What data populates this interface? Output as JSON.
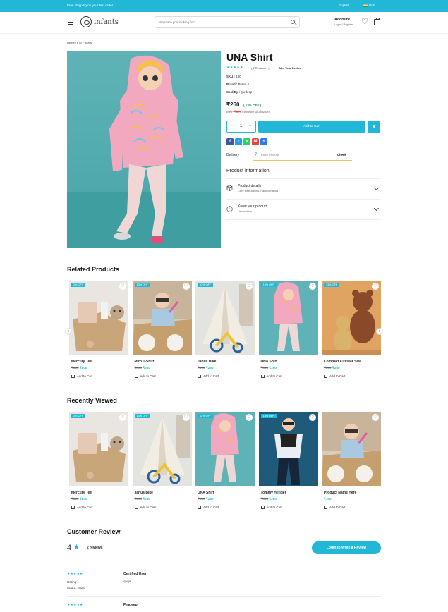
{
  "topbar": {
    "promo": "Free shipping on your first order",
    "language": "English",
    "currency": "INR"
  },
  "header": {
    "logo": "infants",
    "search_placeholder": "What are you looking for?",
    "account_title": "Account",
    "account_sub": "Login / Register"
  },
  "breadcrumb": {
    "home": "Home",
    "sep": "/",
    "current": "6 to 7 years"
  },
  "product": {
    "title": "UNA Shirt",
    "stars": "★★★★★",
    "reviews": "( 2 Reviews )  |",
    "add_review": "Add Your Review",
    "sku_label": "SKU :",
    "sku": "130",
    "brand_label": "Brand :",
    "brand": "Brand 4",
    "sold_label": "Sold By :",
    "sold": "gurdeep",
    "price": "₹260",
    "discount": "( 13% OFF )",
    "mrp_label": "MRP",
    "mrp": "₹300",
    "tax_note": "Inclusive of all taxes",
    "qty": "1",
    "add_to_cart": "Add to Cart",
    "delivery_label": "Delivery",
    "pincode_placeholder": "Enter Pincode",
    "check": "Check",
    "info_title": "Product information",
    "details_title": "Product details",
    "details_sub": "Care instructions, Pack contains",
    "know_title": "Know your product",
    "know_sub": "Description",
    "share": [
      {
        "name": "facebook-icon",
        "glyph": "f",
        "color": "#3b5998"
      },
      {
        "name": "twitter-icon",
        "glyph": "t",
        "color": "#1da1f2"
      },
      {
        "name": "whatsapp-icon",
        "glyph": "w",
        "color": "#25d366"
      },
      {
        "name": "gmail-icon",
        "glyph": "M",
        "color": "#e8453c"
      },
      {
        "name": "share-more-icon",
        "glyph": "+",
        "color": "#2c7be5"
      }
    ]
  },
  "related": {
    "title": "Related Products",
    "items": [
      {
        "badge": "2% OFF",
        "name": "Mercury Tee",
        "mrp": "₹820",
        "price": "₹800",
        "img": "box"
      },
      {
        "badge": "13% OFF",
        "name": "Miro T-Shirt",
        "mrp": "₹300",
        "price": "₹260",
        "img": "boxkid"
      },
      {
        "badge": "13% OFF",
        "name": "Janus Bike",
        "mrp": "₹300",
        "price": "₹260",
        "img": "tent"
      },
      {
        "badge": "13% OFF",
        "name": "UNA Shirt",
        "mrp": "₹300",
        "price": "₹260",
        "img": "girl"
      },
      {
        "badge": "13% OFF",
        "name": "Compact Circular Saw",
        "mrp": "₹300",
        "price": "₹260",
        "img": "bears"
      }
    ]
  },
  "recent": {
    "title": "Recently Viewed",
    "items": [
      {
        "badge": "2% OFF",
        "name": "Mercury Tee",
        "mrp": "₹820",
        "price": "₹800",
        "img": "box"
      },
      {
        "badge": "13% OFF",
        "name": "Janus Bike",
        "mrp": "₹300",
        "price": "₹260",
        "img": "tent"
      },
      {
        "badge": "13% OFF",
        "name": "UNA Shirt",
        "mrp": "₹300",
        "price": "₹260",
        "img": "girl"
      },
      {
        "badge": "13% OFF",
        "name": "Tommy Hilfiger",
        "mrp": "₹300",
        "price": "₹260",
        "img": "boy"
      },
      {
        "badge": "",
        "name": "Product Name Here",
        "mrp": "",
        "price": "₹100",
        "img": "boxkid"
      }
    ]
  },
  "card_add": "Add to Cart",
  "review": {
    "title": "Customer Review",
    "rating": "4",
    "star": "★",
    "count": "2 reviews",
    "login_btn": "Login to Write a Review",
    "entries": [
      {
        "stars": "★★★★★",
        "rating_label": "Rating",
        "date": "Aug 2, 2023",
        "name": "Certified User",
        "body": "qaqa"
      },
      {
        "stars": "★★★★★",
        "rating_label": "",
        "date": "",
        "name": "Pradeep",
        "body": ""
      }
    ]
  },
  "colors": {
    "accent": "#22b7d6",
    "discount": "#1a9b5b",
    "strike": "#e05050"
  }
}
